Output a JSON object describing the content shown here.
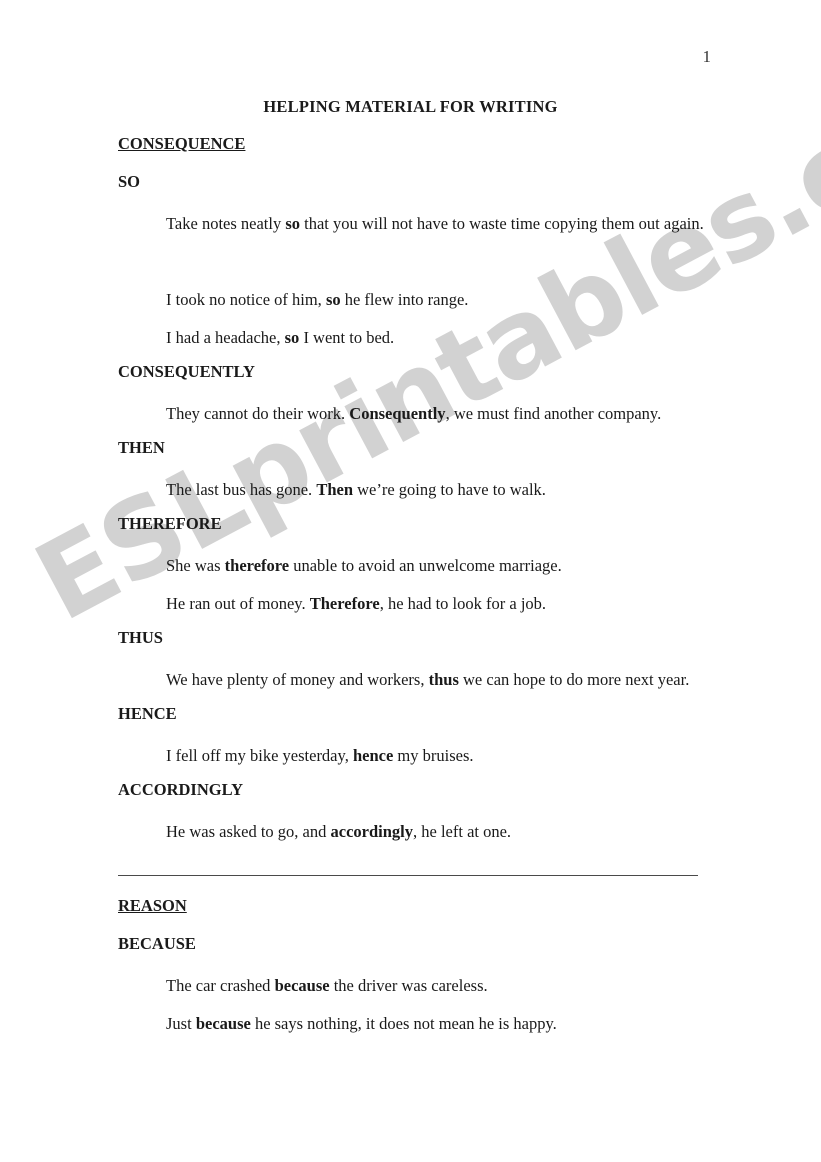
{
  "document": {
    "page_number": "1",
    "title": "HELPING MATERIAL FOR WRITING",
    "watermark": "ESLprintables.com",
    "watermark_color": "#d2d2d2"
  },
  "sections": [
    {
      "heading": "CONSEQUENCE",
      "groups": [
        {
          "sub_heading": "SO",
          "examples": [
            {
              "pre": "Take notes neatly ",
              "bold": "so",
              "post": " that you will not have to waste time copying them out again."
            },
            {
              "pre": "I took no notice of him, ",
              "bold": "so",
              "post": " he flew into range."
            },
            {
              "pre": "I had a headache, ",
              "bold": "so",
              "post": " I went to bed."
            }
          ]
        },
        {
          "sub_heading": "CONSEQUENTLY",
          "examples": [
            {
              "pre": "They cannot do their work. ",
              "bold": "Consequently",
              "post": ", we must find another company."
            }
          ]
        },
        {
          "sub_heading": "THEN",
          "examples": [
            {
              "pre": "The last bus has gone. ",
              "bold": "Then",
              "post": " we’re going to have to walk."
            }
          ]
        },
        {
          "sub_heading": "THEREFORE",
          "examples": [
            {
              "pre": "She was ",
              "bold": "therefore",
              "post": " unable to avoid an unwelcome marriage."
            },
            {
              "pre": "He ran out of money. ",
              "bold": "Therefore",
              "post": ", he had to look for a job."
            }
          ]
        },
        {
          "sub_heading": "THUS",
          "examples": [
            {
              "pre": "We have plenty of money and workers, ",
              "bold": "thus",
              "post": " we can hope to do more next year."
            }
          ]
        },
        {
          "sub_heading": "HENCE",
          "examples": [
            {
              "pre": "I fell off my bike yesterday, ",
              "bold": "hence",
              "post": " my bruises."
            }
          ]
        },
        {
          "sub_heading": "ACCORDINGLY",
          "examples": [
            {
              "pre": "He was asked to go, and ",
              "bold": "accordingly",
              "post": ", he left at one."
            }
          ]
        }
      ]
    },
    {
      "heading": "REASON",
      "groups": [
        {
          "sub_heading": "BECAUSE",
          "examples": [
            {
              "pre": "The car crashed ",
              "bold": "because",
              "post": " the driver was careless."
            },
            {
              "pre": "Just ",
              "bold": "because",
              "post": " he says nothing, it does not mean he is happy."
            }
          ]
        }
      ]
    }
  ]
}
